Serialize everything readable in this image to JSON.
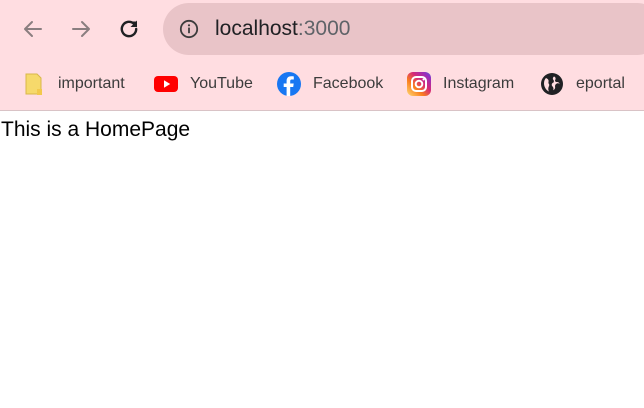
{
  "browser": {
    "colors": {
      "chrome_background": "#ffdde1",
      "omnibox_background": "#e9c4c8",
      "url_port_color": "#5f6368"
    },
    "toolbar": {
      "back_icon": "arrow-left-icon",
      "forward_icon": "arrow-right-icon",
      "reload_icon": "reload-icon",
      "site_info_icon": "info-icon"
    },
    "omnibox": {
      "host": "localhost",
      "port": ":3000"
    },
    "bookmarks": [
      {
        "label": "important",
        "icon": "folder-icon",
        "color": "#f6d96b"
      },
      {
        "label": "YouTube",
        "icon": "youtube-icon",
        "color": "#ff0000"
      },
      {
        "label": "Facebook",
        "icon": "facebook-icon",
        "color": "#1877f2"
      },
      {
        "label": "Instagram",
        "icon": "instagram-icon",
        "color": "#d6249f"
      },
      {
        "label": "eportal",
        "icon": "globe-icon",
        "color": "#202124"
      }
    ]
  },
  "page": {
    "text": "This is a HomePage"
  }
}
